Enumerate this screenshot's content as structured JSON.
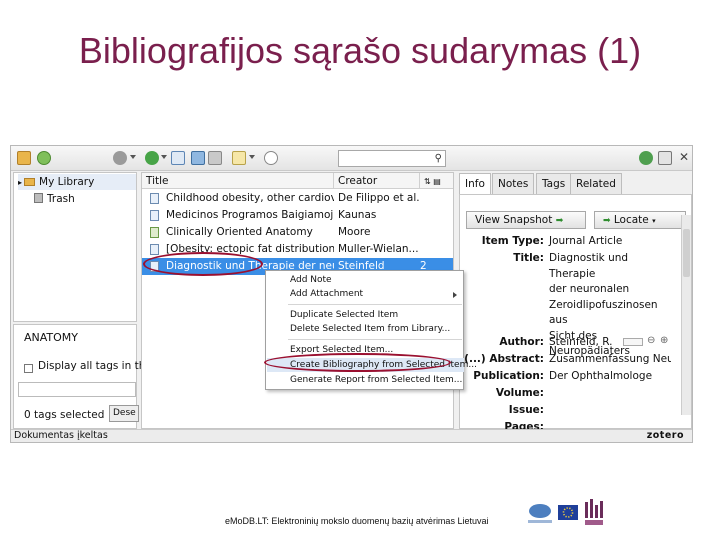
{
  "slide": {
    "title": "Bibliografijos sąrašo sudarymas (1)"
  },
  "collections": {
    "items": [
      {
        "label": "My Library",
        "icon": "folder-icon"
      },
      {
        "label": "Trash",
        "icon": "trash-icon"
      }
    ]
  },
  "tags": {
    "header": "ANATOMY",
    "display_all": "Display all tags in th",
    "count": "0 tags selected",
    "deselect": "Dese"
  },
  "items": {
    "columns": {
      "title": "Title",
      "creator": "Creator"
    },
    "rows": [
      {
        "title": "Childhood obesity, other cardiov...",
        "creator": "De Filippo et al.",
        "att": ""
      },
      {
        "title": "Medicinos Programos Baigiamoj...",
        "creator": "Kaunas",
        "att": ""
      },
      {
        "title": "Clinically Oriented Anatomy",
        "creator": "Moore",
        "att": ""
      },
      {
        "title": "[Obesity: ectopic fat distribution ...",
        "creator": "Muller-Wielan...",
        "att": ""
      },
      {
        "title": "Diagnostik und Therapie der neur...",
        "creator": "Steinfeld",
        "att": "2"
      }
    ]
  },
  "context_menu": {
    "items": [
      "Add Note",
      "Add Attachment",
      "Duplicate Selected Item",
      "Delete Selected Item from Library...",
      "Export Selected Item...",
      "Create Bibliography from Selected Item...",
      "Generate Report from Selected Item..."
    ]
  },
  "info": {
    "tabs": [
      "Info",
      "Notes",
      "Tags",
      "Related"
    ],
    "view_snapshot": "View Snapshot",
    "locate": "Locate",
    "item_type_label": "Item Type:",
    "item_type_value": "Journal Article",
    "title_label": "Title:",
    "title_lines": [
      "Diagnostik und Therapie",
      "der neuronalen",
      "Zeroidlipofuszinosen aus",
      "Sicht des Neuropädiaters"
    ],
    "author_label": "Author:",
    "author_value": "Steinfeld, R.",
    "abstract_label": "(...) Abstract:",
    "abstract_value": "Zusammenfassung Neuro...",
    "publication_label": "Publication:",
    "publication_value": "Der Ophthalmologe",
    "volume_label": "Volume:",
    "issue_label": "Issue:",
    "pages_label": "Pages:"
  },
  "statusbar": {
    "text": "Dokumentas įkeltas",
    "brand": "zotero"
  },
  "footer": {
    "text": "eMoDB.LT: Elektroninių mokslo duomenų bazių atvėrimas Lietuvai"
  },
  "colors": {
    "title": "#7a1f4d",
    "selection": "#3a8ee6",
    "highlight_oval": "#9a1030"
  }
}
